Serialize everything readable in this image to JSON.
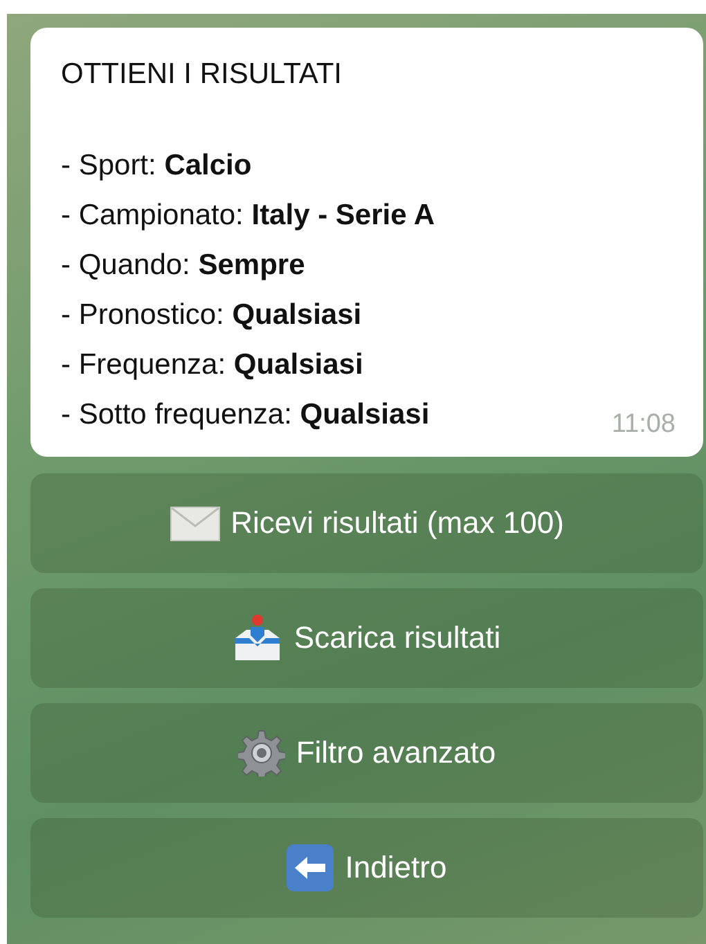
{
  "message": {
    "title": "OTTIENI I RISULTATI",
    "lines": [
      "- Sport: **Calcio**",
      "- Campionato: **Italy - Serie A**",
      "- Quando: **Sempre**",
      "- Pronostico: **Qualsiasi**",
      "- Frequenza: **Qualsiasi**",
      "- Sotto frequenza: **Qualsiasi**"
    ],
    "time": "11:08"
  },
  "buttons": [
    {
      "kind": "envelope",
      "label": "Ricevi risultati (max 100)"
    },
    {
      "kind": "inbox",
      "label": "Scarica risultati"
    },
    {
      "kind": "gear",
      "label": "Filtro avanzato"
    },
    {
      "kind": "back",
      "label": "Indietro"
    }
  ]
}
